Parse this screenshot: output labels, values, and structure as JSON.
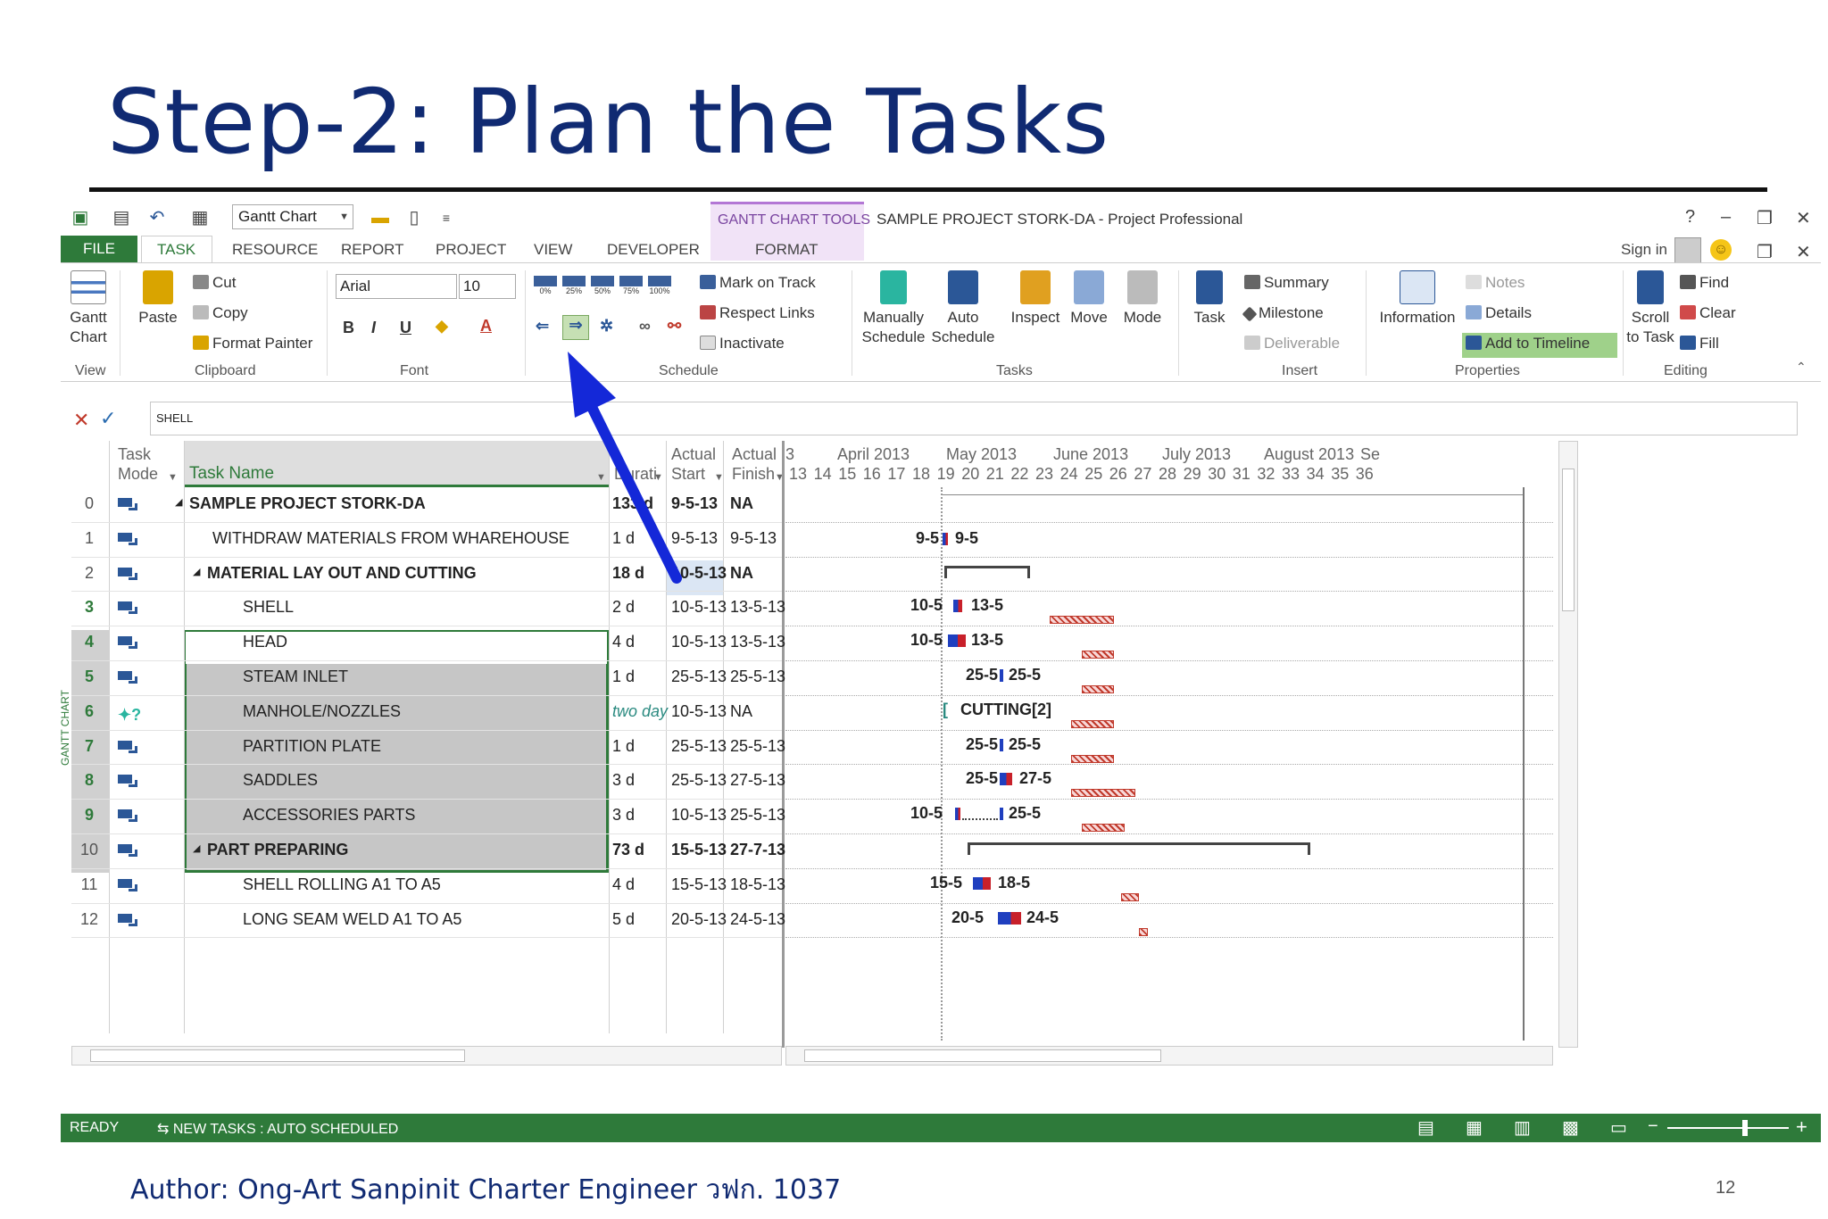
{
  "slide": {
    "title": "Step-2: Plan the Tasks",
    "author": "Author: Ong-Art Sanpinit Charter Engineer วฟก. 1037",
    "page_number": "12"
  },
  "window": {
    "view_dropdown": "Gantt Chart",
    "context_tools": "GANTT CHART TOOLS",
    "title": "SAMPLE PROJECT STORK-DA - Project Professional",
    "help": "?",
    "sign_in": "Sign in"
  },
  "tabs": [
    "FILE",
    "TASK",
    "RESOURCE",
    "REPORT",
    "PROJECT",
    "VIEW",
    "DEVELOPER",
    "FORMAT"
  ],
  "ribbon": {
    "view": {
      "gantt_line1": "Gantt",
      "gantt_line2": "Chart",
      "label": "View"
    },
    "clipboard": {
      "paste": "Paste",
      "cut": "Cut",
      "copy": "Copy",
      "format_painter": "Format Painter",
      "label": "Clipboard"
    },
    "font": {
      "family": "Arial",
      "size": "10",
      "bold": "B",
      "italic": "I",
      "underline": "U",
      "color_letter": "A",
      "label": "Font"
    },
    "schedule": {
      "pct": [
        "0%",
        "25%",
        "50%",
        "75%",
        "100%"
      ],
      "mark_on_track": "Mark on Track",
      "respect_links": "Respect Links",
      "inactivate": "Inactivate",
      "label": "Schedule"
    },
    "tasks": {
      "manual_1": "Manually",
      "manual_2": "Schedule",
      "auto_1": "Auto",
      "auto_2": "Schedule",
      "inspect": "Inspect",
      "move": "Move",
      "mode": "Mode",
      "label": "Tasks"
    },
    "insert": {
      "task": "Task",
      "summary": "Summary",
      "milestone": "Milestone",
      "deliverable": "Deliverable",
      "label": "Insert"
    },
    "properties": {
      "information": "Information",
      "notes": "Notes",
      "details": "Details",
      "add_to_timeline": "Add to Timeline",
      "label": "Properties"
    },
    "editing": {
      "scroll_1": "Scroll",
      "scroll_2": "to Task",
      "find": "Find",
      "clear": "Clear",
      "fill": "Fill",
      "label": "Editing"
    }
  },
  "entry_bar": {
    "value": "SHELL"
  },
  "side_label": "GANTT CHART",
  "columns": {
    "mode_1": "Task",
    "mode_2": "Mode",
    "name": "Task Name",
    "duration": "Durati",
    "astart_1": "Actual",
    "astart_2": "Start",
    "afinish_1": "Actual",
    "afinish_2": "Finish"
  },
  "timescale": {
    "months": [
      "3",
      "April 2013",
      "May 2013",
      "June 2013",
      "July 2013",
      "August 2013",
      "Se"
    ],
    "weeks": [
      "13",
      "14",
      "15",
      "16",
      "17",
      "18",
      "19",
      "20",
      "21",
      "22",
      "23",
      "24",
      "25",
      "26",
      "27",
      "28",
      "29",
      "30",
      "31",
      "32",
      "33",
      "34",
      "35",
      "36"
    ]
  },
  "rows": [
    {
      "id": "0",
      "name": "SAMPLE PROJECT STORK-DA",
      "duration": "133 d",
      "start": "9-5-13",
      "finish": "NA",
      "summary": true,
      "indent": 0
    },
    {
      "id": "1",
      "name": "WITHDRAW MATERIALS FROM WHAREHOUSE",
      "duration": "1 d",
      "start": "9-5-13",
      "finish": "9-5-13",
      "summary": false,
      "indent": 1
    },
    {
      "id": "2",
      "name": "MATERIAL  LAY OUT  AND  CUTTING",
      "duration": "18 d",
      "start": "10-5-13",
      "finish": "NA",
      "summary": true,
      "indent": 1
    },
    {
      "id": "3",
      "name": "SHELL",
      "duration": "2 d",
      "start": "10-5-13",
      "finish": "13-5-13",
      "summary": false,
      "indent": 2
    },
    {
      "id": "4",
      "name": "HEAD",
      "duration": "4 d",
      "start": "10-5-13",
      "finish": "13-5-13",
      "summary": false,
      "indent": 2
    },
    {
      "id": "5",
      "name": "STEAM  INLET",
      "duration": "1 d",
      "start": "25-5-13",
      "finish": "25-5-13",
      "summary": false,
      "indent": 2
    },
    {
      "id": "6",
      "name": "MANHOLE/NOZZLES",
      "duration": "two day",
      "start": "10-5-13",
      "finish": "NA",
      "summary": false,
      "indent": 2
    },
    {
      "id": "7",
      "name": "PARTITION  PLATE",
      "duration": "1 d",
      "start": "25-5-13",
      "finish": "25-5-13",
      "summary": false,
      "indent": 2
    },
    {
      "id": "8",
      "name": "SADDLES",
      "duration": "3 d",
      "start": "25-5-13",
      "finish": "27-5-13",
      "summary": false,
      "indent": 2
    },
    {
      "id": "9",
      "name": "ACCESSORIES  PARTS",
      "duration": "3 d",
      "start": "10-5-13",
      "finish": "25-5-13",
      "summary": false,
      "indent": 2
    },
    {
      "id": "10",
      "name": "PART  PREPARING",
      "duration": "73 d",
      "start": "15-5-13",
      "finish": "27-7-13",
      "summary": true,
      "indent": 1
    },
    {
      "id": "11",
      "name": "SHELL  ROLLING A1 TO A5",
      "duration": "4 d",
      "start": "15-5-13",
      "finish": "18-5-13",
      "summary": false,
      "indent": 2
    },
    {
      "id": "12",
      "name": "LONG SEAM WELD A1 TO A5",
      "duration": "5 d",
      "start": "20-5-13",
      "finish": "24-5-13",
      "summary": false,
      "indent": 2
    }
  ],
  "gantt_labels": {
    "r1_start": "9-5",
    "r1_end": "9-5",
    "r3_start": "10-5",
    "r3_end": "13-5",
    "r4_start": "10-5",
    "r4_end": "13-5",
    "r5_start": "25-5",
    "r5_end": "25-5",
    "r6": "CUTTING[2]",
    "r7_start": "25-5",
    "r7_end": "25-5",
    "r8_start": "25-5",
    "r8_end": "27-5",
    "r9_start": "10-5",
    "r9_end": "25-5",
    "r11_start": "15-5",
    "r11_end": "18-5",
    "r12_start": "20-5",
    "r12_end": "24-5"
  },
  "status_bar": {
    "ready": "READY",
    "new_tasks": "NEW TASKS : AUTO SCHEDULED"
  },
  "colors": {
    "title_blue": "#102a72",
    "ms_green": "#2e7a3a",
    "arrow_blue": "#1428d8",
    "bar_blue": "#1f3fbf",
    "bar_red": "#c8202a"
  }
}
